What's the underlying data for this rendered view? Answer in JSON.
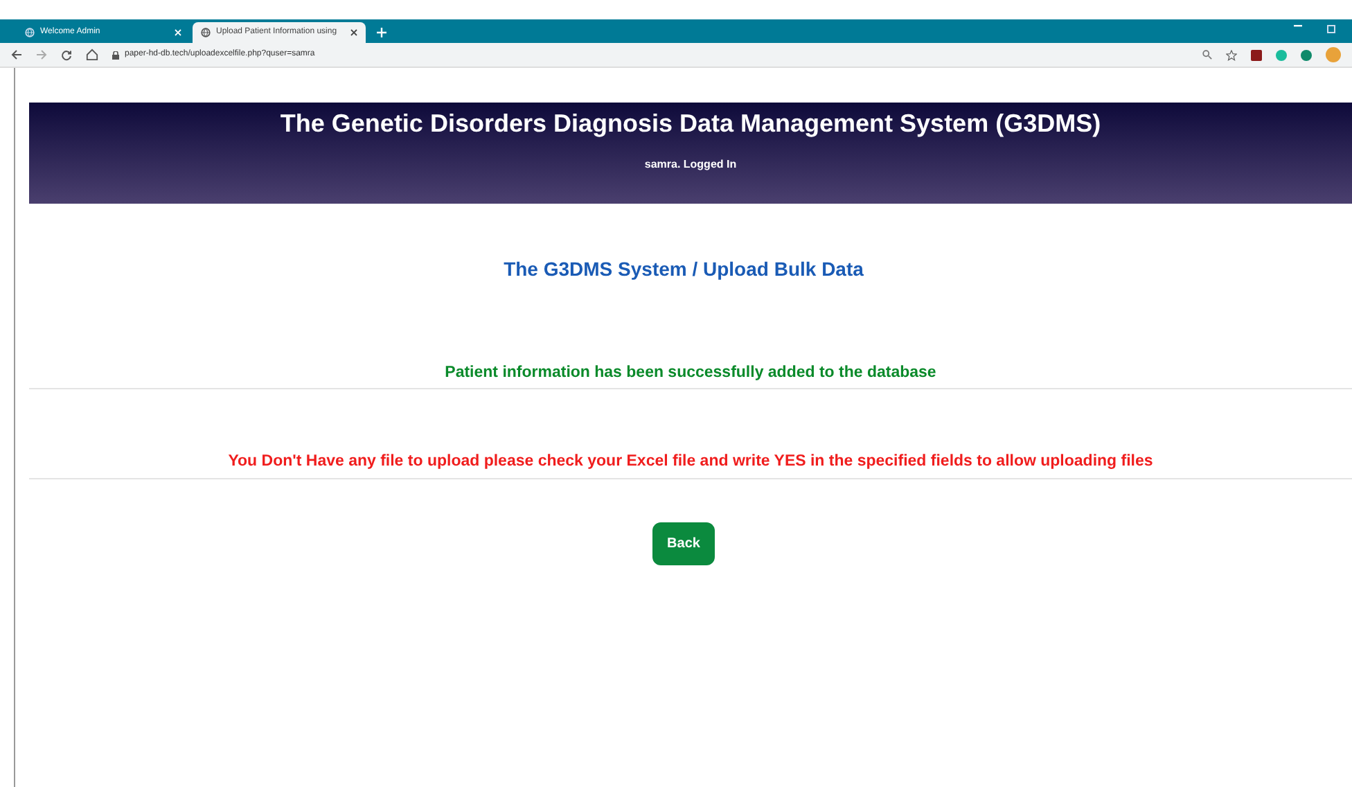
{
  "browser": {
    "tabs": [
      {
        "label": "Welcome Admin",
        "selected": false
      },
      {
        "label": "Upload Patient Information using",
        "selected": true
      }
    ],
    "url": "paper-hd-db.tech/uploadexcelfile.php?quser=samra"
  },
  "header": {
    "title": "The Genetic Disorders Diagnosis Data Management System (G3DMS)",
    "user": "samra. Logged In"
  },
  "breadcrumb": "The G3DMS System / Upload Bulk Data",
  "messages": [
    {
      "text": "Patient information has been successfully added to the database",
      "kind": "success"
    },
    {
      "text": "You Don't Have any file to upload please check your Excel file and write YES in the specified fields to allow uploading files",
      "kind": "error"
    }
  ],
  "back_button": "Back"
}
